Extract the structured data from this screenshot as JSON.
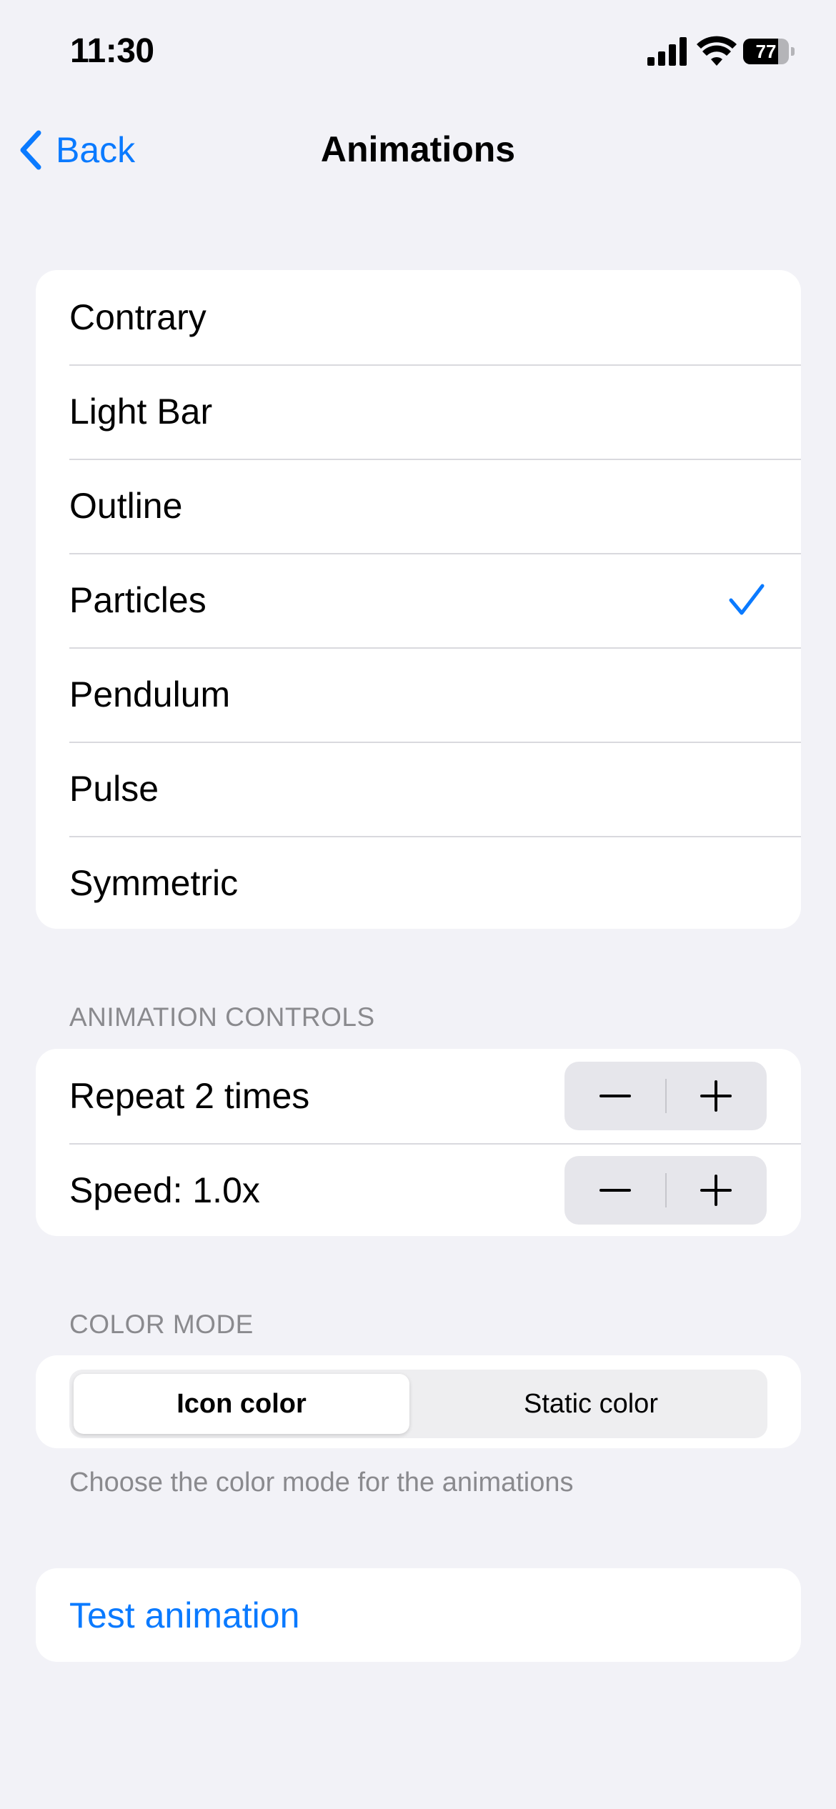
{
  "status_bar": {
    "time": "11:30",
    "battery_level": "77",
    "battery_fraction": 0.77,
    "icons": [
      "cellular-signal-icon",
      "wifi-icon",
      "battery-icon"
    ]
  },
  "nav": {
    "back_label": "Back",
    "title": "Animations"
  },
  "animations": {
    "items": [
      {
        "label": "Contrary",
        "selected": false
      },
      {
        "label": "Light Bar",
        "selected": false
      },
      {
        "label": "Outline",
        "selected": false
      },
      {
        "label": "Particles",
        "selected": true
      },
      {
        "label": "Pendulum",
        "selected": false
      },
      {
        "label": "Pulse",
        "selected": false
      },
      {
        "label": "Symmetric",
        "selected": false
      }
    ]
  },
  "controls": {
    "header": "ANIMATION CONTROLS",
    "repeat_label": "Repeat 2 times",
    "speed_label": "Speed: 1.0x"
  },
  "color_mode": {
    "header": "COLOR MODE",
    "options": [
      "Icon color",
      "Static color"
    ],
    "selected": "Icon color",
    "footer": "Choose the color mode for the animations"
  },
  "test": {
    "label": "Test animation"
  },
  "colors": {
    "accent": "#0a7aff",
    "background": "#f2f2f7",
    "secondary_text": "#8a8a8e"
  }
}
